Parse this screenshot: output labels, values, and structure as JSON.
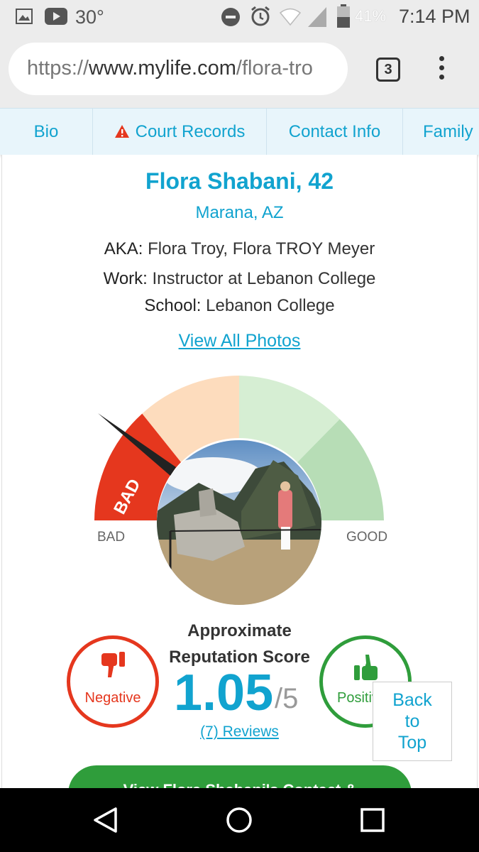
{
  "status_bar": {
    "temperature": "30°",
    "battery_percent": "41%",
    "time": "7:14 PM",
    "icons": [
      "image-icon",
      "youtube-icon",
      "do-not-disturb-icon",
      "alarm-icon",
      "wifi-icon",
      "signal-icon",
      "battery-icon"
    ]
  },
  "browser": {
    "url_scheme": "https://",
    "url_host": "www.mylife.com",
    "url_path": "/flora-tro",
    "tab_count": "3"
  },
  "nav_tabs": {
    "bio": "Bio",
    "court_records": "Court Records",
    "contact_info": "Contact Info",
    "family": "Family"
  },
  "profile": {
    "name": "Flora Shabani, 42",
    "location": "Marana, AZ",
    "aka_label": "AKA:",
    "aka_value": " Flora Troy, Flora TROY Meyer",
    "work_label": "Work:",
    "work_value": " Instructor at Lebanon College",
    "school_label": "School:",
    "school_value": " Lebanon College",
    "view_photos": "View All Photos"
  },
  "gauge": {
    "needle_label": "BAD",
    "left_label": "BAD",
    "right_label": "GOOD",
    "score_fraction": 0.21,
    "colors": {
      "bad": "#e5371e",
      "fair": "#fddcbd",
      "okay": "#d6eed3",
      "good": "#b7ddb6"
    }
  },
  "reputation": {
    "title_line1": "Approximate",
    "title_line2": "Reputation Score",
    "score": "1.05",
    "score_max": "/5",
    "reviews": "(7) Reviews",
    "negative_label": "Negative",
    "positive_label": "Positive"
  },
  "back_to_top": {
    "line1": "Back",
    "line2": "to",
    "line3": "Top"
  },
  "cta": {
    "label": "View Flora Shabani's Contact &"
  },
  "colors": {
    "accent": "#11a3cf",
    "negative": "#e5371e",
    "positive": "#2f9d3b"
  }
}
